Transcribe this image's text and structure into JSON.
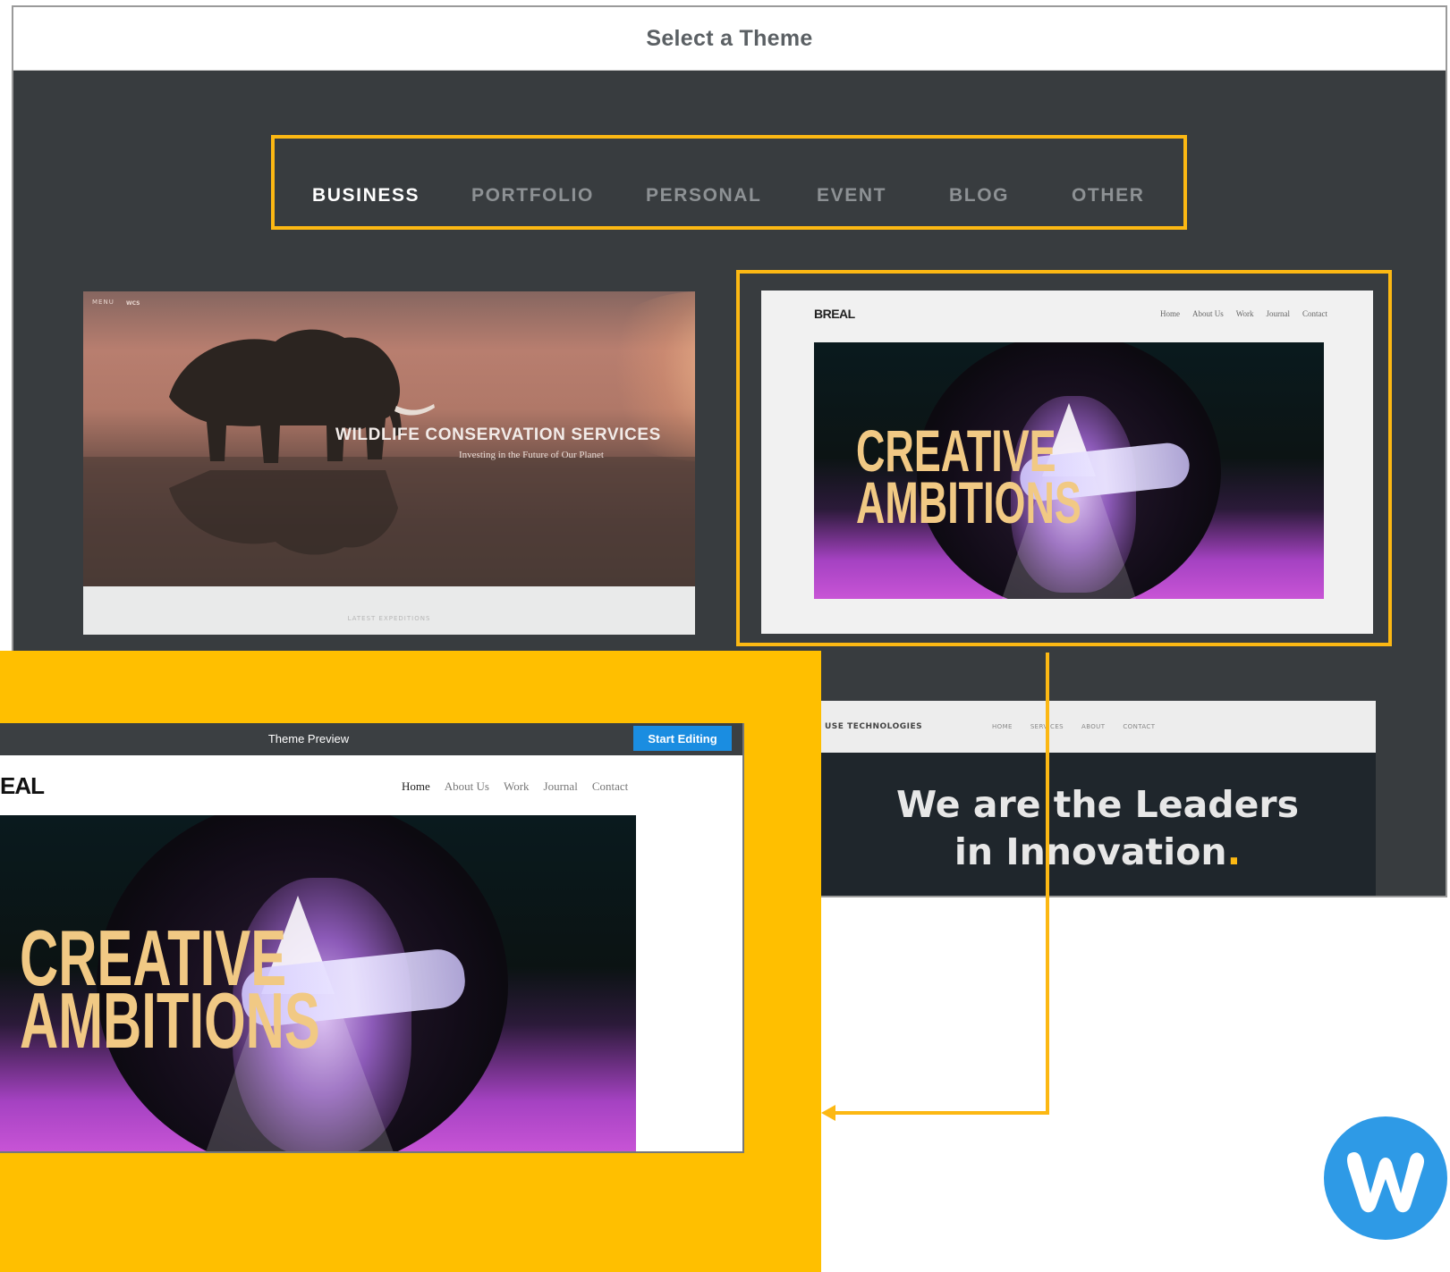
{
  "header": {
    "title": "Select a Theme"
  },
  "tabs": [
    {
      "label": "BUSINESS",
      "active": true
    },
    {
      "label": "PORTFOLIO",
      "active": false
    },
    {
      "label": "PERSONAL",
      "active": false
    },
    {
      "label": "EVENT",
      "active": false
    },
    {
      "label": "BLOG",
      "active": false
    },
    {
      "label": "OTHER",
      "active": false
    }
  ],
  "themes": {
    "wildlife": {
      "menu": "MENU",
      "logo": "WCS",
      "title": "WILDLIFE CONSERVATION SERVICES",
      "subtitle": "Investing in the Future of Our Planet",
      "footer": "LATEST EXPEDITIONS"
    },
    "breal": {
      "logo": "BREAL",
      "nav": [
        "Home",
        "About Us",
        "Work",
        "Journal",
        "Contact"
      ],
      "headline_line1": "CREATIVE",
      "headline_line2": "AMBITIONS"
    },
    "tech": {
      "logo": "USE TECHNOLOGIES",
      "nav": [
        "HOME",
        "SERVICES",
        "ABOUT",
        "CONTACT"
      ],
      "headline_line1": "We are the Leaders",
      "headline_line2": "in Innovation",
      "headline_punct": "."
    }
  },
  "preview": {
    "title": "Theme Preview",
    "start_button": "Start Editing",
    "logo": "EAL",
    "nav": [
      "Home",
      "About Us",
      "Work",
      "Journal",
      "Contact"
    ],
    "headline_line1": "CREATIVE",
    "headline_line2": "AMBITIONS"
  },
  "colors": {
    "highlight": "#fcb813",
    "panel_bg": "#383c3f",
    "button_blue": "#1a8de1",
    "callout_bg": "#ffbf00",
    "weebly_blue": "#2e9ae6"
  },
  "icons": {
    "brand": "weebly-logo-icon"
  }
}
